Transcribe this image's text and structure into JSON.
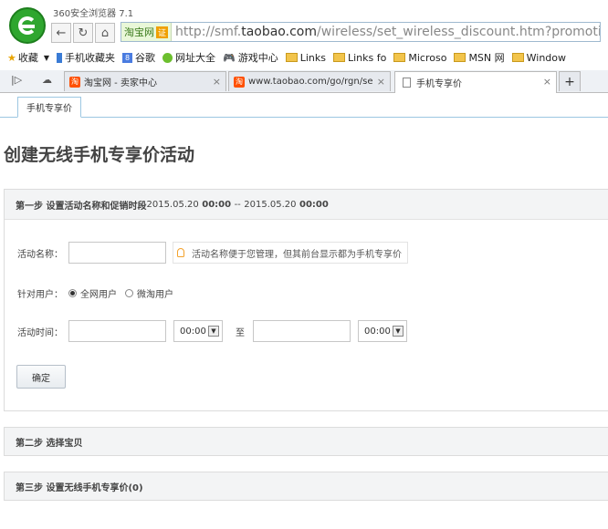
{
  "browser": {
    "title": "360安全浏览器 7.1",
    "site_badge": "淘宝网",
    "site_cert": "证",
    "url_prefix": "http://smf.",
    "url_domain": "taobao.com",
    "url_suffix": "/wireless/set_wireless_discount.htm?promotion_type=",
    "bookmarks": [
      "收藏",
      "手机收藏夹",
      "谷歌",
      "网址大全",
      "游戏中心",
      "Links",
      "Links fo",
      "Microso",
      "MSN 网",
      "Window"
    ],
    "tabs": [
      {
        "label": "淘宝网 - 卖家中心"
      },
      {
        "label": "www.taobao.com/go/rgn/se"
      },
      {
        "label": "手机专享价"
      }
    ],
    "tab_close": "×",
    "new_tab": "+"
  },
  "page": {
    "subtab": "手机专享价",
    "heading": "创建无线手机专享价活动",
    "step1": {
      "label": "第一步 设置活动名称和促销时段",
      "date_start": "2015.05.20",
      "time_start": "00:00",
      "sep": "--",
      "date_end": "2015.05.20",
      "time_end": "00:00"
    },
    "form": {
      "name_label": "活动名称：",
      "name_hint": "活动名称便于您管理，但其前台显示都为手机专享价",
      "user_label": "针对用户：",
      "user_opt1": "全网用户",
      "user_opt2": "微淘用户",
      "time_label": "活动时间：",
      "start_time": "00:00",
      "to": "至",
      "end_time": "00:00",
      "confirm": "确定"
    },
    "step2": "第二步 选择宝贝",
    "step3": "第三步 设置无线手机专享价(0)"
  }
}
